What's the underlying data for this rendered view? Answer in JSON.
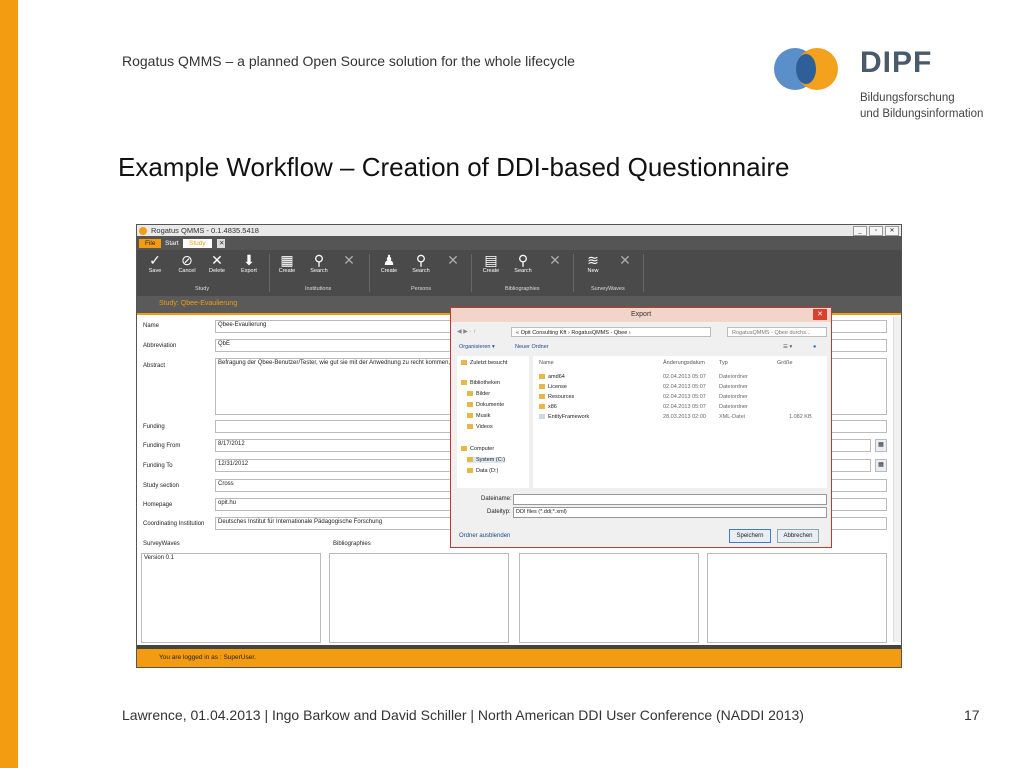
{
  "slide": {
    "header": "Rogatus QMMS – a planned Open Source solution for the whole lifecycle",
    "title": "Example Workflow – Creation of DDI-based Questionnaire",
    "footer": "Lawrence, 01.04.2013 | Ingo Barkow and David Schiller | North American DDI User Conference (NADDI 2013)",
    "page": "17",
    "logo": {
      "name": "DIPF",
      "line1": "Bildungsforschung",
      "line2": "und Bildungsinformation"
    }
  },
  "app": {
    "title": "Rogatus QMMS - 0.1.4835.5418",
    "tabs": [
      "File",
      "Start",
      "Study"
    ],
    "ribbon": {
      "study": [
        {
          "label": "Save",
          "icon": "✓"
        },
        {
          "label": "Cancel",
          "icon": "⊘"
        },
        {
          "label": "Delete",
          "icon": "✕"
        },
        {
          "label": "Export",
          "icon": "⬇"
        }
      ],
      "institutions": [
        {
          "label": "Create",
          "icon": "▦"
        },
        {
          "label": "Search",
          "icon": "⚲"
        },
        {
          "label": "",
          "icon": "✕"
        }
      ],
      "persons": [
        {
          "label": "Create",
          "icon": "♟"
        },
        {
          "label": "Search",
          "icon": "⚲"
        },
        {
          "label": "",
          "icon": "✕"
        }
      ],
      "bibliographies": [
        {
          "label": "Create",
          "icon": "▤"
        },
        {
          "label": "Search",
          "icon": "⚲"
        },
        {
          "label": "",
          "icon": "✕"
        }
      ],
      "surveywaves": [
        {
          "label": "New",
          "icon": "≋"
        },
        {
          "label": "",
          "icon": "✕"
        }
      ],
      "groups": [
        "Study",
        "Institutions",
        "Persons",
        "Bibliographies",
        "SurveyWaves"
      ]
    },
    "study_header": "Study: Qbee-Evaulierung",
    "form": {
      "name_label": "Name",
      "name_value": "Qbee-Evaulierung",
      "abbr_label": "Abbreviation",
      "abbr_value": "QbE",
      "abstract_label": "Abstract",
      "abstract_value": "Befragung der Qbee-Benutzer/Tester, wie gut sie mit der Anwednung zu recht kommen, was",
      "funding_label": "Funding",
      "funding_value": "",
      "from_label": "Funding From",
      "from_value": "8/17/2012",
      "to_label": "Funding To",
      "to_value": "12/31/2012",
      "section_label": "Study section",
      "section_value": "Cross",
      "homepage_label": "Homepage",
      "homepage_value": "opit.hu",
      "inst_label": "Coordinating Institution",
      "inst_value": "Deutsches Institut für Internationale Pädagogische Forschung",
      "waves_label": "SurveyWaves",
      "bib_label": "Bibliographies",
      "waves_item": "Version 0.1"
    },
    "status": "You are logged in as : SuperUser."
  },
  "dialog": {
    "title": "Export",
    "breadcrumb": "« Opit Consulting Kft  ›  RogatusQMMS - Qbee  ›",
    "search_placeholder": "RogatusQMMS - Qbee durchs...",
    "organize": "Organisieren ▾",
    "new_folder": "Neuer Ordner",
    "nav": {
      "recent": "Zuletzt besucht",
      "libraries": "Bibliotheken",
      "pictures": "Bilder",
      "documents": "Dokumente",
      "music": "Musik",
      "videos": "Videos",
      "computer": "Computer",
      "system": "System (C:)",
      "data": "Data (D:)"
    },
    "columns": [
      "Name",
      "Änderungsdatum",
      "Typ",
      "Größe"
    ],
    "files": [
      {
        "name": "amd64",
        "date": "02.04.2013 05:07",
        "type": "Dateiordner",
        "size": ""
      },
      {
        "name": "License",
        "date": "02.04.2013 05:07",
        "type": "Dateiordner",
        "size": ""
      },
      {
        "name": "Resources",
        "date": "02.04.2013 05:07",
        "type": "Dateiordner",
        "size": ""
      },
      {
        "name": "x86",
        "date": "02.04.2013 05:07",
        "type": "Dateiordner",
        "size": ""
      },
      {
        "name": "EntityFramework",
        "date": "28.03.2013 02:00",
        "type": "XML-Datei",
        "size": "1.082 KB"
      }
    ],
    "filename_label": "Dateiname:",
    "filename_value": "",
    "filetype_label": "Dateityp:",
    "filetype_value": "DDI files (*.ddi;*.xml)",
    "hide_folders": "Ordner ausblenden",
    "save": "Speichern",
    "cancel": "Abbrechen"
  }
}
